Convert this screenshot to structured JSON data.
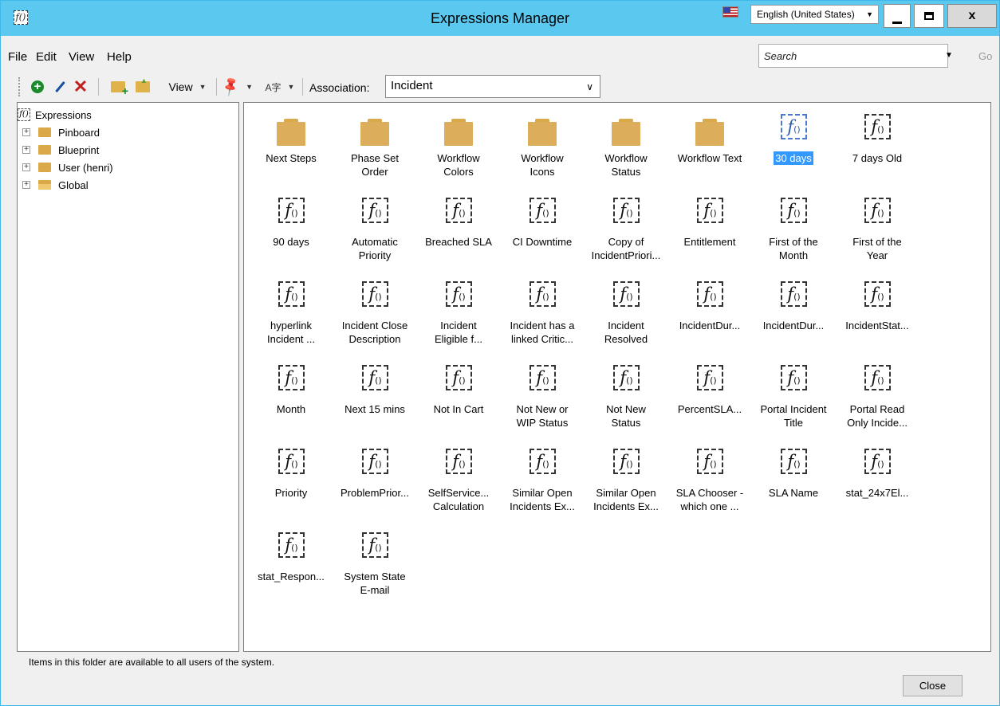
{
  "window": {
    "title": "Expressions Manager",
    "app_icon_label": "f()",
    "language": "English (United States)"
  },
  "menu": [
    "File",
    "Edit",
    "View",
    "Help"
  ],
  "search": {
    "placeholder": "Search",
    "go_label": "Go"
  },
  "toolbar": {
    "view_label": "View",
    "association_label": "Association:",
    "association_value": "Incident",
    "font_glyph": "A字"
  },
  "tree": {
    "root": "Expressions",
    "items": [
      "Pinboard",
      "Blueprint",
      "User (henri)",
      "Global"
    ],
    "selected": "Global"
  },
  "folders": [
    [
      "Next Steps"
    ],
    [
      "Phase Set",
      "Order"
    ],
    [
      "Workflow",
      "Colors"
    ],
    [
      "Workflow",
      "Icons"
    ],
    [
      "Workflow",
      "Status"
    ],
    [
      "Workflow Text"
    ]
  ],
  "expressions": [
    [
      "30 days"
    ],
    [
      "7 days Old"
    ],
    [
      "90 days"
    ],
    [
      "Automatic",
      "Priority"
    ],
    [
      "Breached SLA"
    ],
    [
      "CI Downtime"
    ],
    [
      "Copy of",
      "IncidentPriori..."
    ],
    [
      "Entitlement"
    ],
    [
      "First of the",
      "Month"
    ],
    [
      "First of the",
      "Year"
    ],
    [
      "hyperlink",
      "Incident ..."
    ],
    [
      "Incident Close",
      "Description"
    ],
    [
      "Incident",
      "Eligible f..."
    ],
    [
      "Incident has a",
      "linked Critic..."
    ],
    [
      "Incident",
      "Resolved"
    ],
    [
      "IncidentDur..."
    ],
    [
      "IncidentDur..."
    ],
    [
      "IncidentStat..."
    ],
    [
      "Month"
    ],
    [
      "Next 15 mins"
    ],
    [
      "Not In Cart"
    ],
    [
      "Not New or",
      "WIP Status"
    ],
    [
      "Not New",
      "Status"
    ],
    [
      "PercentSLA..."
    ],
    [
      "Portal Incident",
      "Title"
    ],
    [
      "Portal Read",
      "Only Incide..."
    ],
    [
      "Priority"
    ],
    [
      "ProblemPrior..."
    ],
    [
      "SelfService...",
      "Calculation"
    ],
    [
      "Similar Open",
      "Incidents Ex..."
    ],
    [
      "Similar Open",
      "Incidents Ex..."
    ],
    [
      "SLA Chooser -",
      "which one ..."
    ],
    [
      "SLA Name"
    ],
    [
      "stat_24x7El..."
    ],
    [
      "stat_Respon..."
    ],
    [
      "System State",
      "E-mail"
    ]
  ],
  "selected_item": "30 days",
  "fx_glyph": "f",
  "fx_paren": "()",
  "status_text": "Items in this folder are available to all users of the system.",
  "close_label": "Close"
}
